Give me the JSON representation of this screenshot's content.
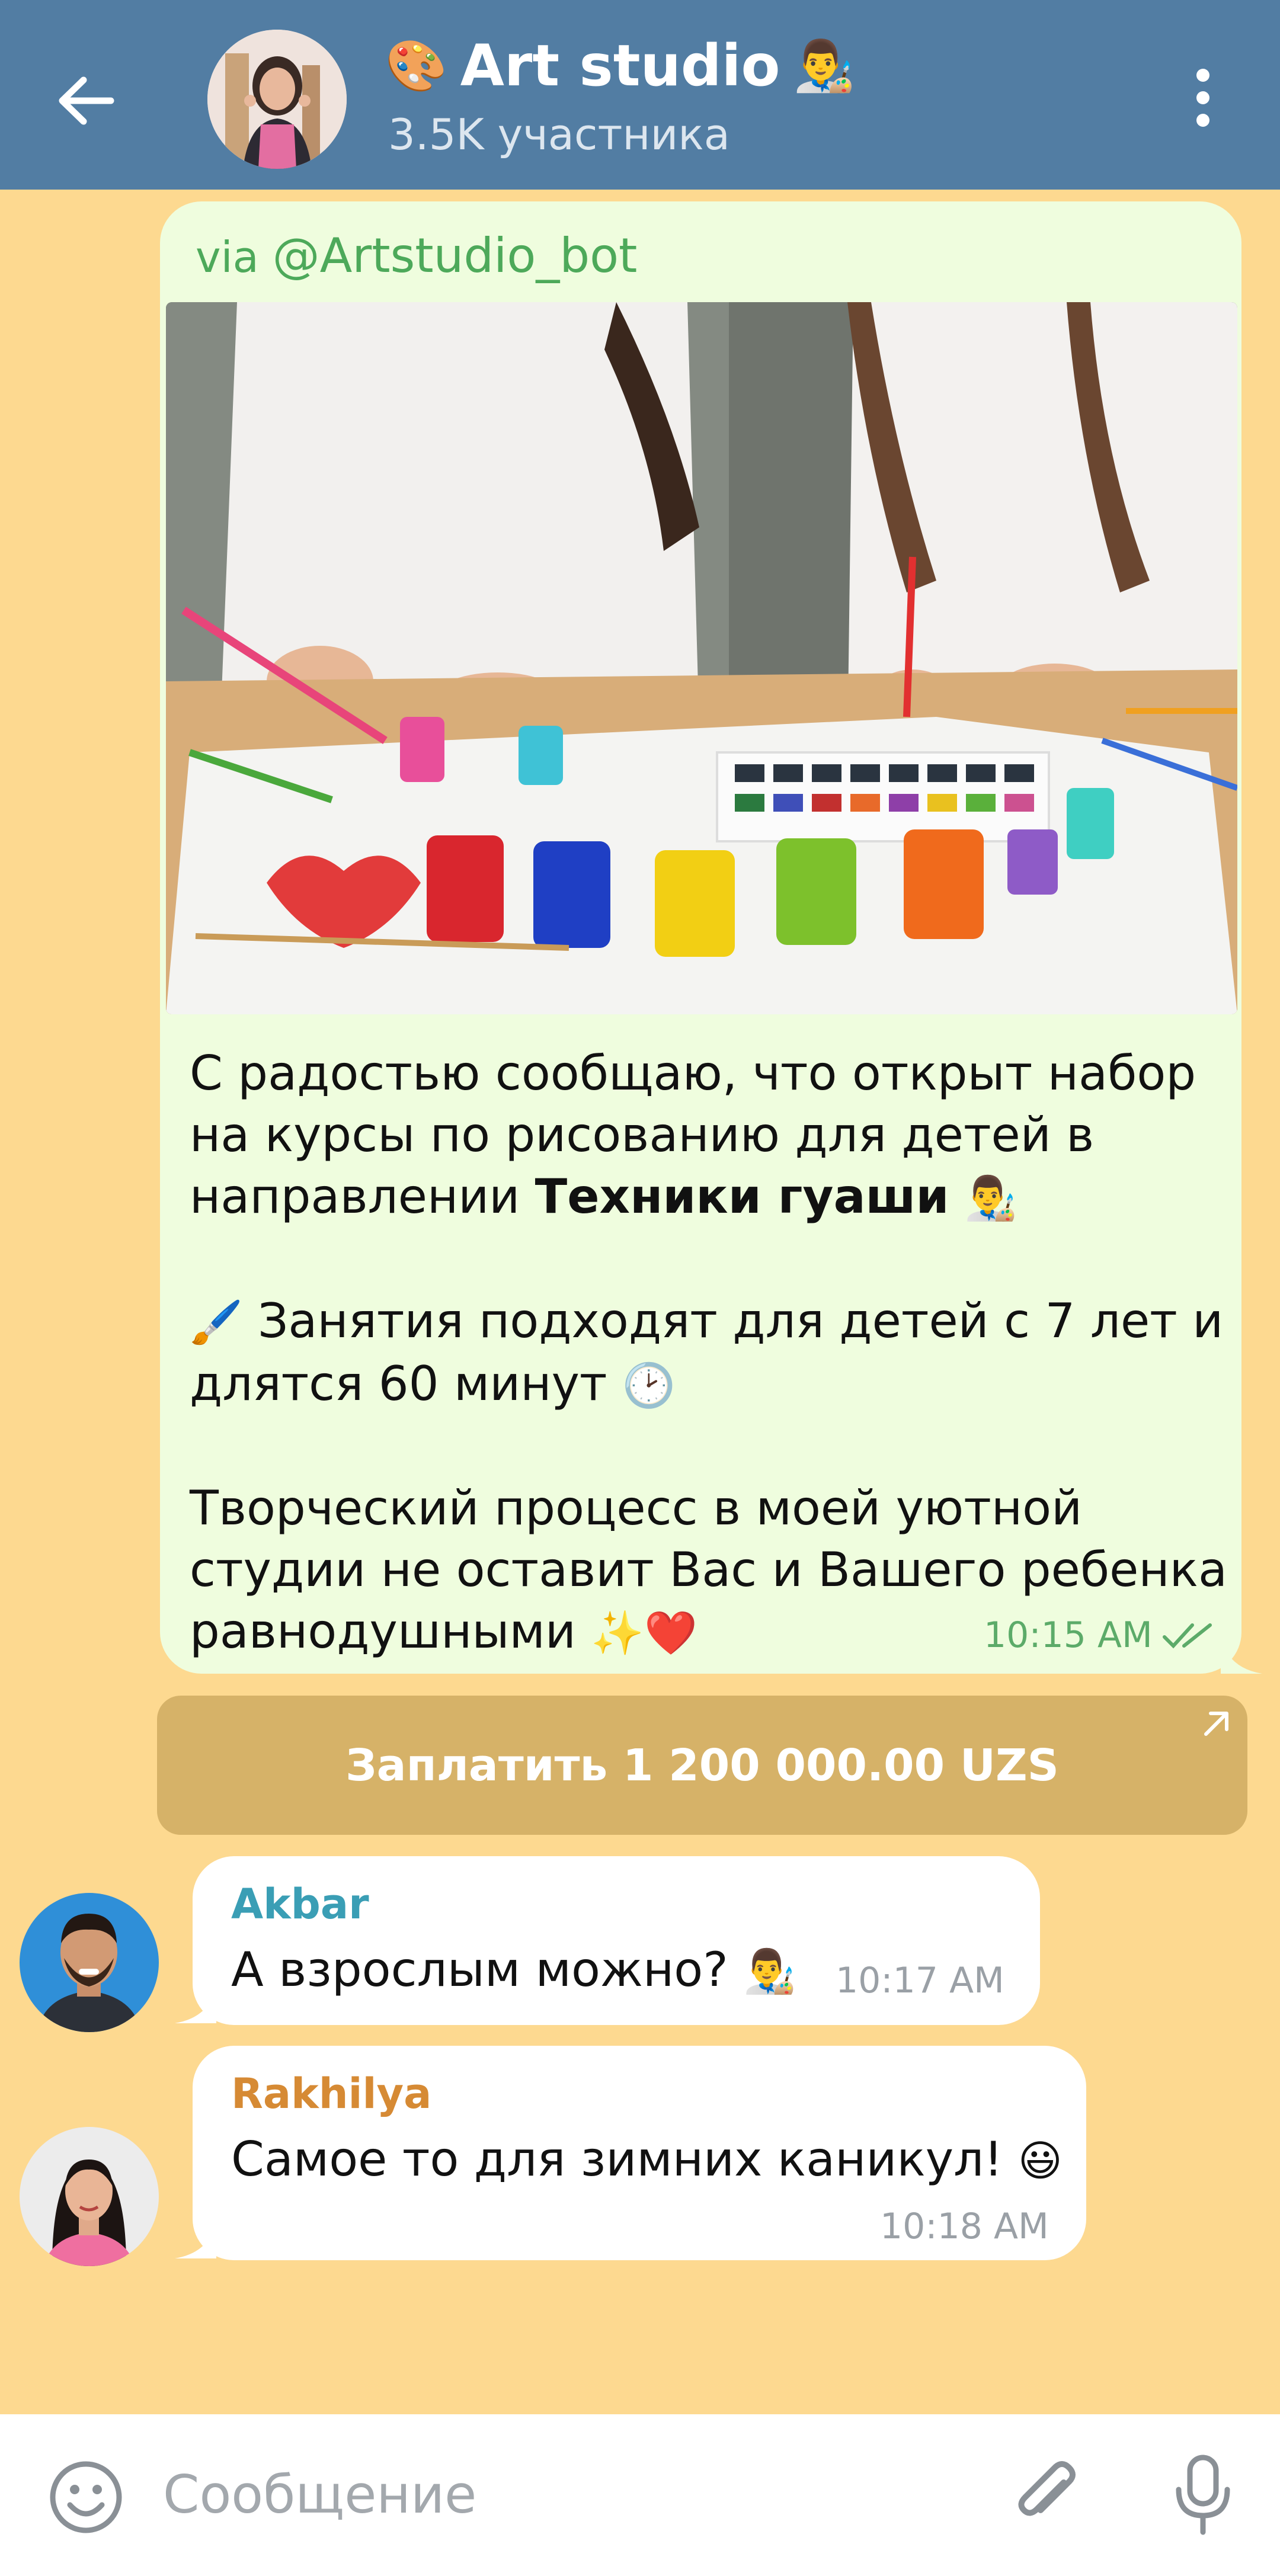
{
  "header": {
    "title": "Art studio",
    "subtitle": "3.5K участника",
    "title_emoji_left": "🎨",
    "title_emoji_right": "👨‍🎨"
  },
  "post": {
    "via_prefix": "via",
    "via_bot": "@Artstudio_bot",
    "text": {
      "line1": "С радостью сообщаю, что открыт набор",
      "line2": "на курсы по рисованию для детей в",
      "line3_plain": "направлении ",
      "line3_bold": "Техники гуаши",
      "line3_emoji": "👨‍🎨",
      "line4_emoji": "🖌️",
      "line4": "Занятия подходят для детей с 7 лет и",
      "line5": "длятся 60 минут",
      "line5_emoji": "🕑",
      "line6": "Творческий процесс в моей уютной",
      "line7": "студии не оставит Вас и Вашего ребенка",
      "line8": "равнодушными",
      "line8_emoji": "✨❤️"
    },
    "time": "10:15 AM"
  },
  "pay_button": {
    "label": "Заплатить 1 200 000.00 UZS"
  },
  "messages": [
    {
      "sender": "Akbar",
      "sender_color": "#3a9eb5",
      "text": "А взрослым можно?",
      "emoji": "👨‍🎨",
      "time": "10:17 AM"
    },
    {
      "sender": "Rakhilya",
      "sender_color": "#d68a34",
      "text": "Самое то для зимних каникул!",
      "emoji": "😃",
      "time": "10:18 AM"
    }
  ],
  "composer": {
    "placeholder": "Сообщение"
  },
  "colors": {
    "header": "#527da3",
    "background": "#fdd990",
    "outgoing_bubble": "#effdde",
    "pay_button": "#d6b268",
    "accent_green": "#4da95a"
  }
}
